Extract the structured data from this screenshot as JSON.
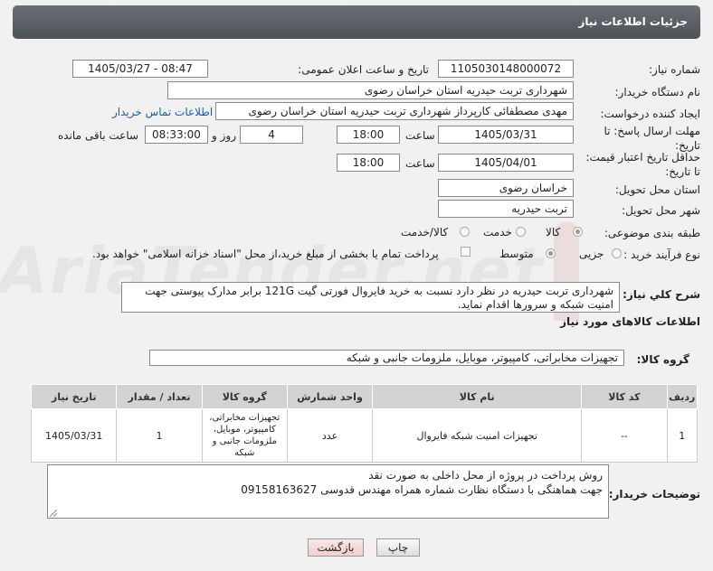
{
  "page_title": "جزئیات اطلاعات نیاز",
  "fields": {
    "need_number_label": "شماره نیاز:",
    "need_number": "1105030148000072",
    "announce_label": "تاریخ و ساعت اعلان عمومی:",
    "announce_value": "1405/03/27 - 08:47",
    "buyer_org_label": "نام دستگاه خریدار:",
    "buyer_org": "شهرداری تربت حیدریه استان خراسان رضوی",
    "creator_label": "ایجاد کننده درخواست:",
    "creator": "مهدی مصطفائی کارپرداز شهرداری تربت حیدریه استان خراسان رضوی",
    "contact_link": "اطلاعات تماس خریدار",
    "deadline_label": "مهلت ارسال پاسخ: تا تاریخ:",
    "deadline_date": "1405/03/31",
    "time_label": "ساعت",
    "deadline_time": "18:00",
    "days_value": "4",
    "days_label": "روز و",
    "remaining_time": "08:33:00",
    "remaining_label": "ساعت باقی مانده",
    "price_validity_label": "حداقل تاریخ اعتبار قیمت: تا تاریخ:",
    "price_validity_date": "1405/04/01",
    "price_validity_time": "18:00",
    "delivery_province_label": "استان محل تحویل:",
    "delivery_province": "خراسان رضوی",
    "delivery_city_label": "شهر محل تحویل:",
    "delivery_city": "تربت حیدریه",
    "category_label": "طبقه بندی موضوعی:",
    "category_options": [
      "کالا",
      "خدمت",
      "کالا/خدمت"
    ],
    "process_label": "نوع فرآیند خرید :",
    "process_options": [
      "جزیی",
      "متوسط"
    ],
    "payment_note": "پرداخت تمام یا بخشی از مبلغ خرید،از محل \"اسناد خزانه اسلامی\" خواهد بود."
  },
  "description": {
    "label": "شرح کلي نياز:",
    "text": "شهرداری تربت حیدریه در نظر دارد نسبت به خرید فایروال فورتی گیت 121G برابر مدارک پیوستی جهت امنیت شبکه و سرورها اقدام نماید."
  },
  "goods_info_title": "اطلاعات کالاهای مورد نیاز",
  "goods_group": {
    "label": "گروه کالا:",
    "value": "تجهیزات مخابراتی، کامپیوتر، موبایل، ملزومات جانبی و شبکه"
  },
  "table": {
    "headers": [
      "ردیف",
      "کد کالا",
      "نام کالا",
      "واحد شمارش",
      "گروه کالا",
      "تعداد / مقدار",
      "تاریخ نیاز"
    ],
    "rows": [
      {
        "row": "1",
        "code": "--",
        "name": "تجهیزات امنیت شبکه فایروال",
        "unit": "عدد",
        "group": "تجهیزات مخابراتی، کامپیوتر، موبایل، ملزومات جانبی و شبکه",
        "qty": "1",
        "date": "1405/03/31"
      }
    ]
  },
  "buyer_notes": {
    "label": "توضیحات خریدار:",
    "line1": "روش پرداخت در پروژه از محل داخلی به صورت نقد",
    "line2": "جهت هماهنگی با دستگاه نظارت شماره همراه مهندس قدوسی 09158163627"
  },
  "buttons": {
    "print": "چاپ",
    "back": "بازگشت"
  },
  "watermark_text": "AriaTender.net",
  "colors": {
    "title_bar": "#5a5f64",
    "link": "#1a5ea8",
    "back_button_bg": "#f6d9d9"
  }
}
